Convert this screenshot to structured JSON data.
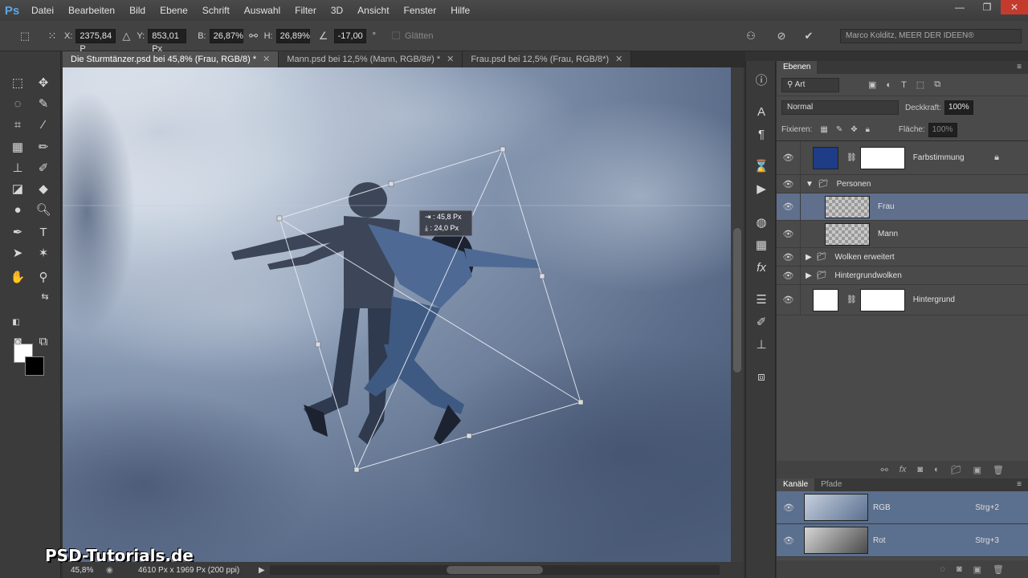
{
  "app": {
    "logo": "Ps"
  },
  "menu": [
    "Datei",
    "Bearbeiten",
    "Bild",
    "Ebene",
    "Schrift",
    "Auswahl",
    "Filter",
    "3D",
    "Ansicht",
    "Fenster",
    "Hilfe"
  ],
  "window_controls": {
    "minimize": "—",
    "restore": "❐",
    "close": "✕"
  },
  "options": {
    "x_label": "X:",
    "x_value": "2375,84 P",
    "y_label": "Y:",
    "y_value": "853,01 Px",
    "w_label": "B:",
    "w_value": "26,87%",
    "h_label": "H:",
    "h_value": "26,89%",
    "angle_value": "-17,00",
    "degree": "°",
    "smooth_label": "Glätten",
    "account": "Marco Kolditz, MEER DER IDEEN®"
  },
  "tabs": [
    {
      "label": "Die Sturmtänzer.psd bei 45,8% (Frau, RGB/8) *",
      "close": "✕"
    },
    {
      "label": "Mann.psd bei 12,5% (Mann, RGB/8#) *",
      "close": "✕"
    },
    {
      "label": "Frau.psd bei 12,5% (Frau, RGB/8*)",
      "close": "✕"
    }
  ],
  "transform_tooltip": {
    "line1": "⇥ : 45,8 Px",
    "line2": "⤓ : 24,0 Px"
  },
  "status": {
    "zoom": "45,8%",
    "doc_size": "4610 Px x 1969 Px (200 ppi)"
  },
  "watermark": "PSD-Tutorials.de",
  "layers_panel": {
    "tab": "Ebenen",
    "filter_kind": "Art",
    "blend_mode": "Normal",
    "opacity_label": "Deckkraft:",
    "opacity_value": "100%",
    "lock_label": "Fixieren:",
    "fill_label": "Fläche:",
    "fill_value": "100%",
    "layers": [
      {
        "name": "Farbstimmung"
      },
      {
        "name": "Personen"
      },
      {
        "name": "Frau"
      },
      {
        "name": "Mann"
      },
      {
        "name": "Wolken erweitert"
      },
      {
        "name": "Hintergrundwolken"
      },
      {
        "name": "Hintergrund"
      }
    ]
  },
  "channels_panel": {
    "tabs": [
      "Kanäle",
      "Pfade"
    ],
    "channels": [
      {
        "name": "RGB",
        "shortcut": "Strg+2"
      },
      {
        "name": "Rot",
        "shortcut": "Strg+3"
      }
    ]
  }
}
